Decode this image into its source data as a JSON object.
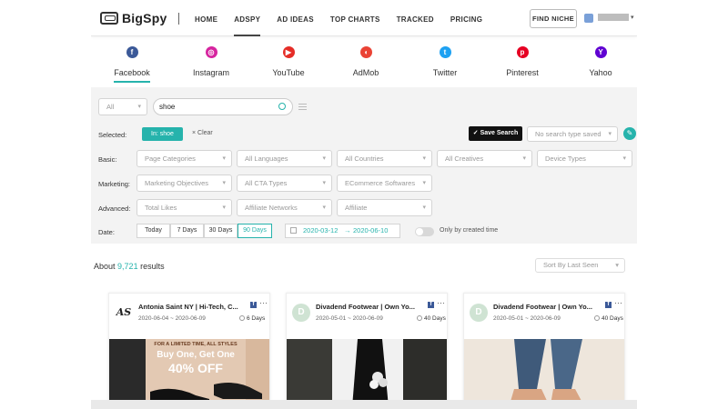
{
  "header": {
    "brand": "BigSpy",
    "nav": [
      "HOME",
      "ADSPY",
      "AD IDEAS",
      "TOP CHARTS",
      "TRACKED",
      "PRICING"
    ],
    "active_nav": "ADSPY",
    "find_niche": "FIND NICHE"
  },
  "platforms": [
    {
      "label": "Facebook",
      "icon": "facebook-icon",
      "color": "#3b5998",
      "glyph": "f"
    },
    {
      "label": "Instagram",
      "icon": "instagram-icon",
      "color": "#d6249f",
      "glyph": "◎"
    },
    {
      "label": "YouTube",
      "icon": "youtube-icon",
      "color": "#e52d27",
      "glyph": "▶"
    },
    {
      "label": "AdMob",
      "icon": "admob-icon",
      "color": "#ea4335",
      "glyph": "◖"
    },
    {
      "label": "Twitter",
      "icon": "twitter-icon",
      "color": "#1da1f2",
      "glyph": "t"
    },
    {
      "label": "Pinterest",
      "icon": "pinterest-icon",
      "color": "#e60023",
      "glyph": "p"
    },
    {
      "label": "Yahoo",
      "icon": "yahoo-icon",
      "color": "#6001d2",
      "glyph": "Y"
    }
  ],
  "filters": {
    "scope": "All",
    "search_value": "shoe",
    "selected_label": "Selected:",
    "selected_chip": "In: shoe",
    "clear": "× Clear",
    "save_search": "Save Search",
    "saved_placeholder": "No search type saved",
    "basic_label": "Basic:",
    "basic": [
      "Page Categories",
      "All Languages",
      "All Countries",
      "All Creatives",
      "Device Types"
    ],
    "marketing_label": "Marketing:",
    "marketing": [
      "Marketing Objectives",
      "All CTA Types",
      "ECommerce Softwares"
    ],
    "advanced_label": "Advanced:",
    "advanced": [
      "Total Likes",
      "Affiliate Networks",
      "Affiliate"
    ],
    "date_label": "Date:",
    "date_options": [
      "Today",
      "7 Days",
      "30 Days",
      "90 Days"
    ],
    "active_date": "90 Days",
    "date_from": "2020-03-12",
    "date_to": "2020-06-10",
    "date_sep": "→",
    "only_created": "Only by created time"
  },
  "results": {
    "prefix": "About",
    "count": "9,721",
    "suffix": "results",
    "sort": "Sort By Last Seen"
  },
  "cards": [
    {
      "title": "Antonia Saint NY | Hi-Tech, C...",
      "dates": "2020-06-04 ~ 2020-06-09",
      "days": "6 Days",
      "avatar": "AS",
      "promo_line1": "FOR A LIMITED TIME, ALL STYLES",
      "promo_line2": "Buy One, Get One",
      "promo_line3": "40% OFF"
    },
    {
      "title": "Divadend Footwear | Own Yo...",
      "dates": "2020-05-01 ~ 2020-06-09",
      "days": "40 Days",
      "avatar": "D"
    },
    {
      "title": "Divadend Footwear | Own Yo...",
      "dates": "2020-05-01 ~ 2020-06-09",
      "days": "40 Days",
      "avatar": "D"
    }
  ],
  "colors": {
    "accent": "#26b3ac",
    "dark": "#111111"
  }
}
